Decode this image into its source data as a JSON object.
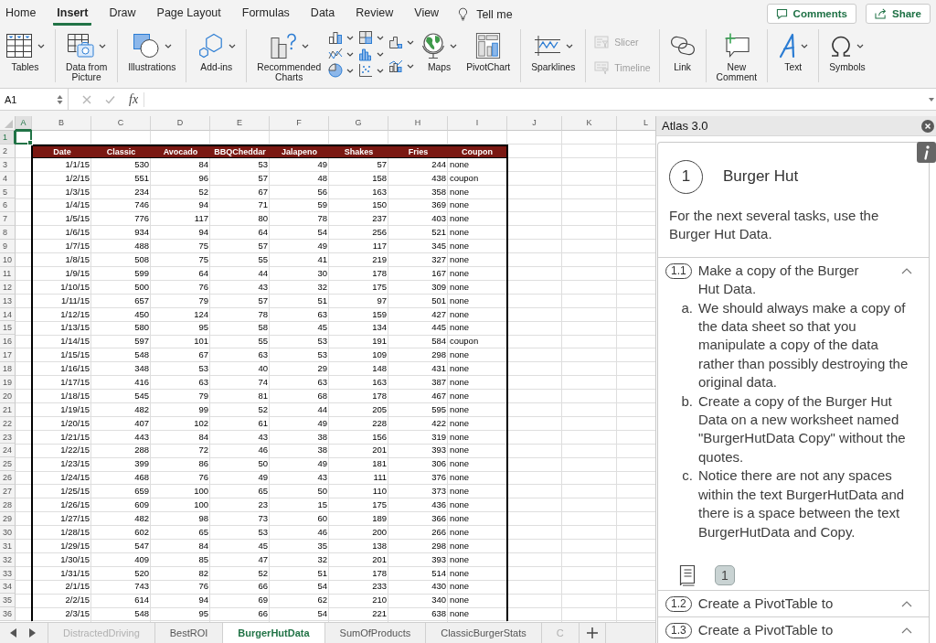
{
  "menu_tabs": [
    {
      "label": "Home",
      "selected": false
    },
    {
      "label": "Insert",
      "selected": true
    },
    {
      "label": "Draw",
      "selected": false
    },
    {
      "label": "Page Layout",
      "selected": false
    },
    {
      "label": "Formulas",
      "selected": false
    },
    {
      "label": "Data",
      "selected": false
    },
    {
      "label": "Review",
      "selected": false
    },
    {
      "label": "View",
      "selected": false
    }
  ],
  "tell_me": "Tell me",
  "header_buttons": [
    "Comments",
    "Share"
  ],
  "ribbon": {
    "groups": [
      {
        "items": [
          {
            "kind": "large",
            "label": "Tables",
            "dropdown": true,
            "disabled": false
          }
        ]
      },
      {
        "items": [
          {
            "kind": "large",
            "label": "Data from\nPicture",
            "dropdown": true,
            "disabled": false
          }
        ]
      },
      {
        "items": [
          {
            "kind": "large",
            "label": "Illustrations",
            "dropdown": true,
            "disabled": false
          }
        ]
      },
      {
        "items": [
          {
            "kind": "large",
            "label": "Add-ins",
            "dropdown": true,
            "disabled": false
          }
        ]
      },
      {
        "items": [
          {
            "kind": "large",
            "label": "Recommended\nCharts",
            "dropdown": true,
            "disabled": false
          },
          {
            "kind": "chart-icons",
            "dropdown": true,
            "disabled": false
          },
          {
            "kind": "large",
            "label": "Maps",
            "dropdown": true,
            "disabled": false
          },
          {
            "kind": "large",
            "label": "PivotChart",
            "dropdown": false,
            "disabled": false
          }
        ]
      },
      {
        "items": [
          {
            "kind": "large",
            "label": "Sparklines",
            "dropdown": true,
            "disabled": false
          }
        ]
      },
      {
        "items": [
          {
            "kind": "small",
            "label": "Slicer",
            "dropdown": false,
            "disabled": true
          },
          {
            "kind": "small",
            "label": "Timeline",
            "dropdown": false,
            "disabled": true
          }
        ]
      },
      {
        "items": [
          {
            "kind": "large",
            "label": "Link",
            "dropdown": false,
            "disabled": false
          }
        ]
      },
      {
        "items": [
          {
            "kind": "large",
            "label": "New\nComment",
            "dropdown": false,
            "disabled": false
          }
        ]
      },
      {
        "items": [
          {
            "kind": "large",
            "label": "Text",
            "dropdown": true,
            "disabled": false
          }
        ]
      },
      {
        "items": [
          {
            "kind": "large",
            "label": "Symbols",
            "dropdown": true,
            "disabled": false
          }
        ]
      }
    ]
  },
  "formula_bar": {
    "name_box": "A1",
    "function_label": "fx"
  },
  "sheet": {
    "columns": [
      {
        "label": "A",
        "selected": true
      },
      {
        "label": "B",
        "selected": false
      },
      {
        "label": "C",
        "selected": false
      },
      {
        "label": "D",
        "selected": false
      },
      {
        "label": "E",
        "selected": false
      },
      {
        "label": "F",
        "selected": false
      },
      {
        "label": "G",
        "selected": false
      },
      {
        "label": "H",
        "selected": false
      },
      {
        "label": "I",
        "selected": false
      },
      {
        "label": "J",
        "selected": false
      },
      {
        "label": "K",
        "selected": false
      },
      {
        "label": "L",
        "selected": false
      }
    ],
    "rows": [
      {
        "label": "1",
        "selected": true
      },
      {
        "label": "2",
        "selected": false
      },
      {
        "label": "3",
        "selected": false
      },
      {
        "label": "4",
        "selected": false
      },
      {
        "label": "5",
        "selected": false
      },
      {
        "label": "6",
        "selected": false
      },
      {
        "label": "7",
        "selected": false
      },
      {
        "label": "8",
        "selected": false
      },
      {
        "label": "9",
        "selected": false
      },
      {
        "label": "10",
        "selected": false
      },
      {
        "label": "11",
        "selected": false
      },
      {
        "label": "12",
        "selected": false
      },
      {
        "label": "13",
        "selected": false
      },
      {
        "label": "14",
        "selected": false
      },
      {
        "label": "15",
        "selected": false
      },
      {
        "label": "16",
        "selected": false
      },
      {
        "label": "17",
        "selected": false
      },
      {
        "label": "18",
        "selected": false
      },
      {
        "label": "19",
        "selected": false
      },
      {
        "label": "20",
        "selected": false
      },
      {
        "label": "21",
        "selected": false
      },
      {
        "label": "22",
        "selected": false
      },
      {
        "label": "23",
        "selected": false
      },
      {
        "label": "24",
        "selected": false
      },
      {
        "label": "25",
        "selected": false
      },
      {
        "label": "26",
        "selected": false
      },
      {
        "label": "27",
        "selected": false
      },
      {
        "label": "28",
        "selected": false
      },
      {
        "label": "29",
        "selected": false
      },
      {
        "label": "30",
        "selected": false
      },
      {
        "label": "31",
        "selected": false
      },
      {
        "label": "32",
        "selected": false
      },
      {
        "label": "33",
        "selected": false
      },
      {
        "label": "34",
        "selected": false
      },
      {
        "label": "35",
        "selected": false
      },
      {
        "label": "36",
        "selected": false
      }
    ],
    "table": {
      "columns": [
        {
          "label": "Date",
          "kind": "date"
        },
        {
          "label": "Classic",
          "kind": "number"
        },
        {
          "label": "Avocado",
          "kind": "number"
        },
        {
          "label": "BBQCheddar",
          "kind": "number"
        },
        {
          "label": "Jalapeno",
          "kind": "number"
        },
        {
          "label": "Shakes",
          "kind": "number"
        },
        {
          "label": "Fries",
          "kind": "number"
        },
        {
          "label": "Coupon",
          "kind": "text"
        }
      ],
      "rows": [
        [
          "1/1/15",
          "530",
          "84",
          "53",
          "49",
          "57",
          "244",
          "none"
        ],
        [
          "1/2/15",
          "551",
          "96",
          "57",
          "48",
          "158",
          "438",
          "coupon"
        ],
        [
          "1/3/15",
          "234",
          "52",
          "67",
          "56",
          "163",
          "358",
          "none"
        ],
        [
          "1/4/15",
          "746",
          "94",
          "71",
          "59",
          "150",
          "369",
          "none"
        ],
        [
          "1/5/15",
          "776",
          "117",
          "80",
          "78",
          "237",
          "403",
          "none"
        ],
        [
          "1/6/15",
          "934",
          "94",
          "64",
          "54",
          "256",
          "521",
          "none"
        ],
        [
          "1/7/15",
          "488",
          "75",
          "57",
          "49",
          "117",
          "345",
          "none"
        ],
        [
          "1/8/15",
          "508",
          "75",
          "55",
          "41",
          "219",
          "327",
          "none"
        ],
        [
          "1/9/15",
          "599",
          "64",
          "44",
          "30",
          "178",
          "167",
          "none"
        ],
        [
          "1/10/15",
          "500",
          "76",
          "43",
          "32",
          "175",
          "309",
          "none"
        ],
        [
          "1/11/15",
          "657",
          "79",
          "57",
          "51",
          "97",
          "501",
          "none"
        ],
        [
          "1/12/15",
          "450",
          "124",
          "78",
          "63",
          "159",
          "427",
          "none"
        ],
        [
          "1/13/15",
          "580",
          "95",
          "58",
          "45",
          "134",
          "445",
          "none"
        ],
        [
          "1/14/15",
          "597",
          "101",
          "55",
          "53",
          "191",
          "584",
          "coupon"
        ],
        [
          "1/15/15",
          "548",
          "67",
          "63",
          "53",
          "109",
          "298",
          "none"
        ],
        [
          "1/16/15",
          "348",
          "53",
          "40",
          "29",
          "148",
          "431",
          "none"
        ],
        [
          "1/17/15",
          "416",
          "63",
          "74",
          "63",
          "163",
          "387",
          "none"
        ],
        [
          "1/18/15",
          "545",
          "79",
          "81",
          "68",
          "178",
          "467",
          "none"
        ],
        [
          "1/19/15",
          "482",
          "99",
          "52",
          "44",
          "205",
          "595",
          "none"
        ],
        [
          "1/20/15",
          "407",
          "102",
          "61",
          "49",
          "228",
          "422",
          "none"
        ],
        [
          "1/21/15",
          "443",
          "84",
          "43",
          "38",
          "156",
          "319",
          "none"
        ],
        [
          "1/22/15",
          "288",
          "72",
          "46",
          "38",
          "201",
          "393",
          "none"
        ],
        [
          "1/23/15",
          "399",
          "86",
          "50",
          "49",
          "181",
          "306",
          "none"
        ],
        [
          "1/24/15",
          "468",
          "76",
          "49",
          "43",
          "111",
          "376",
          "none"
        ],
        [
          "1/25/15",
          "659",
          "100",
          "65",
          "50",
          "110",
          "373",
          "none"
        ],
        [
          "1/26/15",
          "609",
          "100",
          "23",
          "15",
          "175",
          "436",
          "none"
        ],
        [
          "1/27/15",
          "482",
          "98",
          "73",
          "60",
          "189",
          "366",
          "none"
        ],
        [
          "1/28/15",
          "602",
          "65",
          "53",
          "46",
          "200",
          "266",
          "none"
        ],
        [
          "1/29/15",
          "547",
          "84",
          "45",
          "35",
          "138",
          "298",
          "none"
        ],
        [
          "1/30/15",
          "409",
          "85",
          "47",
          "32",
          "201",
          "393",
          "none"
        ],
        [
          "1/31/15",
          "520",
          "82",
          "52",
          "51",
          "178",
          "514",
          "none"
        ],
        [
          "2/1/15",
          "743",
          "76",
          "66",
          "54",
          "233",
          "430",
          "none"
        ],
        [
          "2/2/15",
          "614",
          "94",
          "69",
          "62",
          "210",
          "340",
          "none"
        ],
        [
          "2/3/15",
          "548",
          "95",
          "66",
          "54",
          "221",
          "638",
          "none"
        ]
      ]
    }
  },
  "sheet_tabs": [
    {
      "label": "DistractedDriving",
      "selected": false,
      "dimmed": true
    },
    {
      "label": "BestROI",
      "selected": false,
      "dimmed": false
    },
    {
      "label": "BurgerHutData",
      "selected": true,
      "dimmed": false
    },
    {
      "label": "SumOfProducts",
      "selected": false,
      "dimmed": false
    },
    {
      "label": "ClassicBurgerStats",
      "selected": false,
      "dimmed": false
    },
    {
      "label": "C",
      "selected": false,
      "dimmed": true
    }
  ],
  "panel": {
    "title": "Atlas 3.0",
    "section": {
      "number": "1",
      "title": "Burger Hut",
      "intro": "For the next several tasks, use the Burger Hut Data."
    },
    "tasks": [
      {
        "number": "1.1",
        "title": "Make a copy of the Burger Hut Data.",
        "steps": [
          {
            "marker": "a.",
            "text": "We should always make a copy of the data sheet so that you manipulate a copy of the data rather than possibly destroying the original data."
          },
          {
            "marker": "b.",
            "text": "Create a copy of the Burger Hut Data on a new worksheet named \"BurgerHutData Copy\" without the quotes."
          },
          {
            "marker": "c.",
            "text": "Notice there are not any spaces within the text BurgerHutData and there is a space between the text BurgerHutData and Copy."
          }
        ],
        "resource_count": "1"
      },
      {
        "number": "1.2",
        "title": "Create a PivotTable to"
      },
      {
        "number": "1.3",
        "title": "Create a PivotTable to"
      }
    ]
  }
}
